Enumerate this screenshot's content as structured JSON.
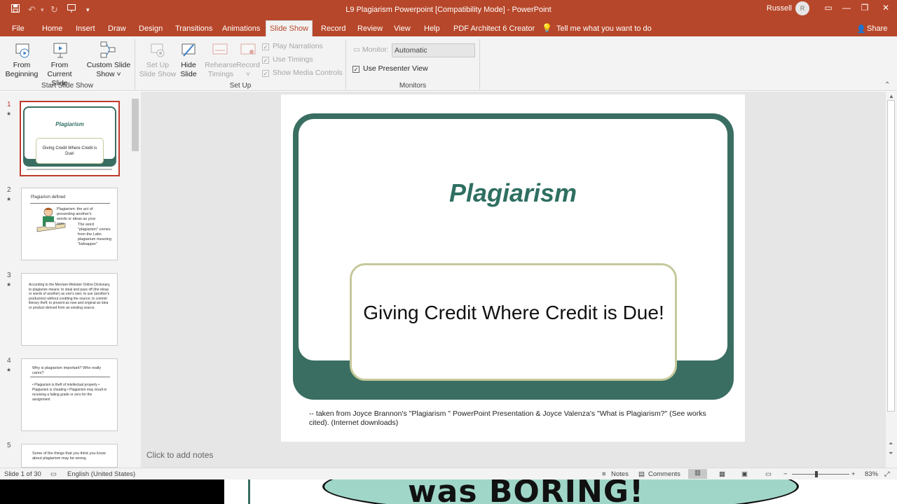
{
  "titlebar": {
    "title": "L9 Plagiarism Powerpoint [Compatibility Mode]  -  PowerPoint",
    "user": "Russell",
    "avatar": "R"
  },
  "tabs": [
    "File",
    "Home",
    "Insert",
    "Draw",
    "Design",
    "Transitions",
    "Animations",
    "Slide Show",
    "Record",
    "Review",
    "View",
    "Help",
    "PDF Architect 6 Creator"
  ],
  "active_tab": "Slide Show",
  "tell_me": "Tell me what you want to do",
  "share": "Share",
  "ribbon": {
    "from_beginning": [
      "From",
      "Beginning"
    ],
    "from_current": [
      "From",
      "Current Slide"
    ],
    "custom_show": [
      "Custom Slide",
      "Show ˅"
    ],
    "group_start": "Start Slide Show",
    "setup_show": [
      "Set Up",
      "Slide Show"
    ],
    "hide_slide": [
      "Hide",
      "Slide"
    ],
    "rehearse": [
      "Rehearse",
      "Timings"
    ],
    "record": [
      "Record",
      "˅"
    ],
    "play_narrations": "Play Narrations",
    "use_timings": "Use Timings",
    "show_media": "Show Media Controls",
    "group_setup": "Set Up",
    "monitor_label": "Monitor:",
    "monitor_value": "Automatic",
    "presenter_view": "Use Presenter View",
    "group_monitors": "Monitors"
  },
  "thumbnails": [
    {
      "num": "1",
      "title": "Plagiarism",
      "sub": "Giving Credit Where Credit is Due!"
    },
    {
      "num": "2",
      "title": "Plagiarism defined",
      "body": "Plagiarism: the act of presenting another's words or ideas as your own",
      "body2": "The word \"plagiarism\" comes from the Latin plagiarium meaning \"kidnapper\""
    },
    {
      "num": "3",
      "body": "According to the Merriam-Webster Online Dictionary, to plagiarize means: to steal and pass off (the ideas or words of another) as one's own; to use (another's production) without crediting the source; to commit literary theft; to present as new and original an idea or product derived from an existing source."
    },
    {
      "num": "4",
      "title": "Why is plagiarism important? Who really cares?",
      "body": "• Plagiarism is theft of intellectual property • Plagiarism is cheating • Plagiarism may result in receiving a failing grade or zero for the assignment"
    },
    {
      "num": "5",
      "body": "Some of the things that you think you know about plagiarism may be wrong."
    }
  ],
  "slide": {
    "title": "Plagiarism",
    "subtitle": "Giving Credit Where Credit is Due!",
    "credit": "-- taken from Joyce Brannon's \"Plagiarism \"  PowerPoint Presentation & Joyce Valenza's \"What is Plagiarism?\" (See works cited). (Internet downloads)"
  },
  "notes_placeholder": "Click to add notes",
  "status": {
    "slide_count": "Slide 1 of 30",
    "language": "English (United States)",
    "notes": "Notes",
    "comments": "Comments",
    "zoom": "83%"
  },
  "overlay_text": "was BORING!",
  "colors": {
    "accent": "#b7472a",
    "slide_green": "#3a6e62",
    "title_green": "#2f6f62",
    "box_border": "#c6c99a"
  }
}
